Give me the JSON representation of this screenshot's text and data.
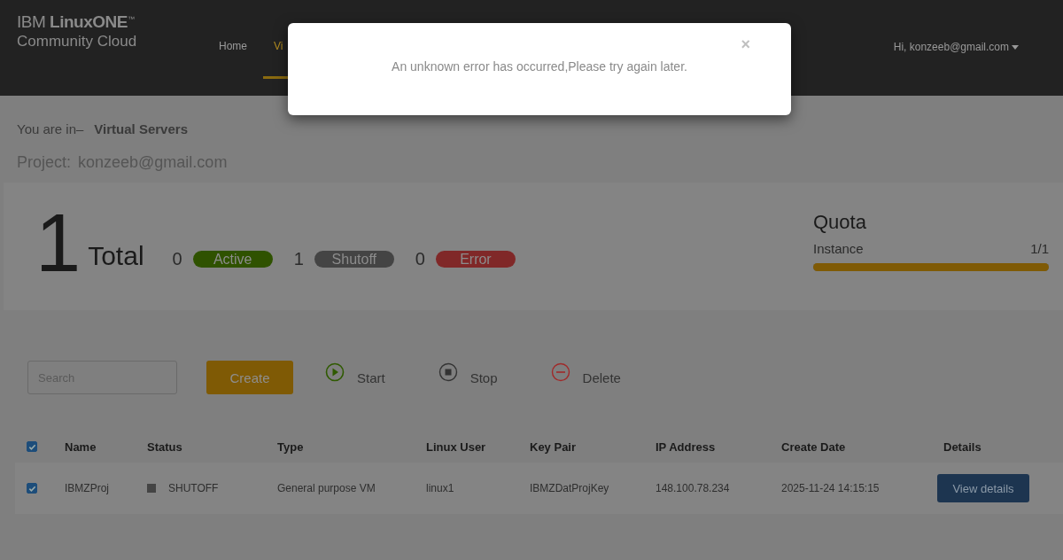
{
  "header": {
    "logo": {
      "brand": "IBM",
      "product": "LinuxONE",
      "tm": "™",
      "subtitle": "Community Cloud"
    },
    "nav": [
      {
        "label": "Home",
        "selected": false
      },
      {
        "label": "Vi",
        "selected": true
      }
    ],
    "user_menu": "Hi, konzeeb@gmail.com"
  },
  "breadcrumb": {
    "prefix": "You are in–",
    "current": "Virtual Servers"
  },
  "project": {
    "label": "Project:",
    "value": "konzeeb@gmail.com"
  },
  "summary": {
    "total": "1",
    "total_label": "Total",
    "statuses": [
      {
        "count": "0",
        "label": "Active",
        "color": "#2f5200"
      },
      {
        "count": "1",
        "label": "Shutoff",
        "color": "#444444"
      },
      {
        "count": "0",
        "label": "Error",
        "color": "#802828"
      }
    ]
  },
  "quota": {
    "title": "Quota",
    "label": "Instance",
    "reading": "1/1",
    "level": 1
  },
  "toolbar": {
    "search": {
      "placeholder": "Search"
    },
    "create": "Create",
    "actions": [
      {
        "kind": "start",
        "label": "Start"
      },
      {
        "kind": "stop",
        "label": "Stop"
      },
      {
        "kind": "delete",
        "label": "Delete"
      }
    ]
  },
  "table": {
    "all_checked": true,
    "columns": [
      "Name",
      "Status",
      "Type",
      "Linux User",
      "Key Pair",
      "IP Address",
      "Create Date",
      "Details"
    ],
    "rows": [
      {
        "checked": true,
        "name": "IBMZProj",
        "status": "SHUTOFF",
        "type": "General purpose VM",
        "user": "linux1",
        "key_pair": "IBMZDatProjKey",
        "ip": "148.100.78.234",
        "date": "2025-11-24 14:15:15",
        "action": "View details"
      }
    ]
  },
  "modal": {
    "message": "An unknown error has occurred,Please try again later.",
    "close": "×"
  }
}
